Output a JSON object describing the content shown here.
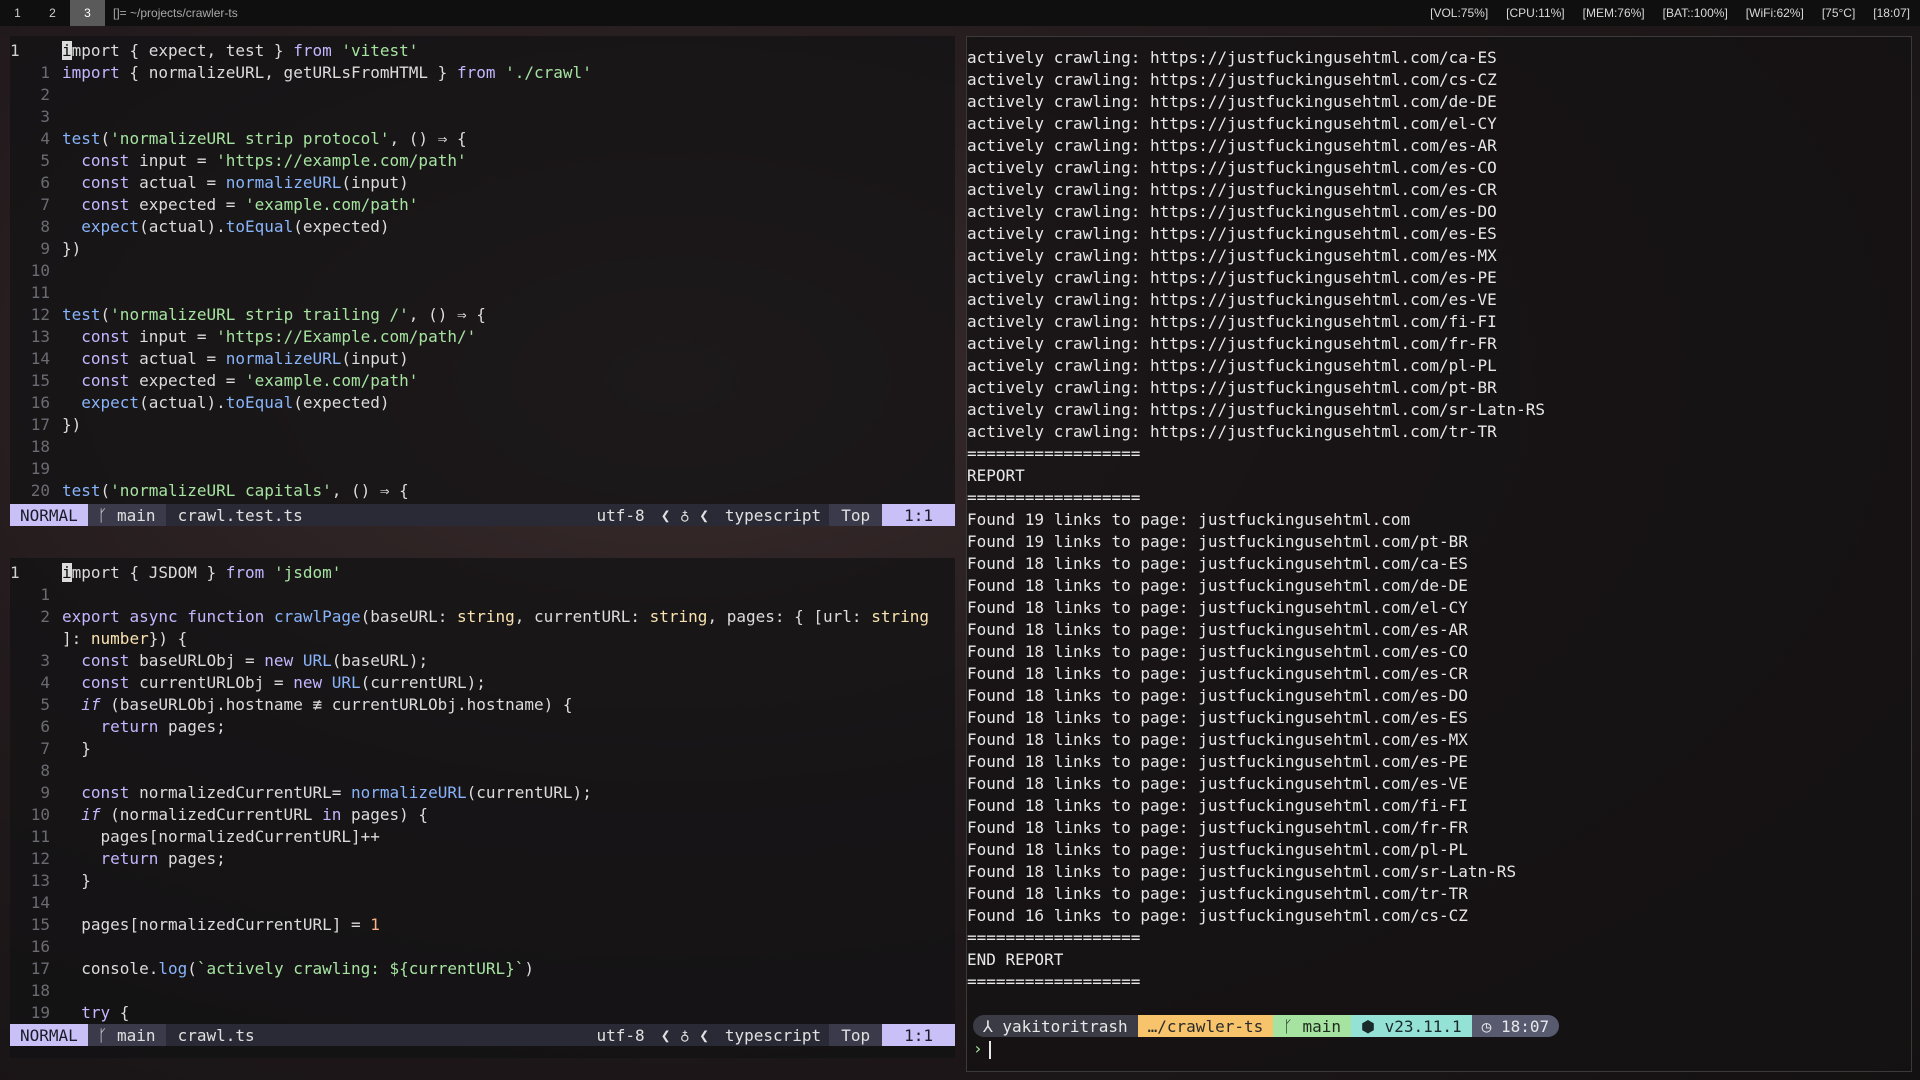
{
  "topbar": {
    "workspaces": [
      "1",
      "2",
      "3"
    ],
    "window_title": "[]= ~/projects/crawler-ts",
    "status": [
      "[VOL:75%]",
      "[CPU:11%]",
      "[MEM:76%]",
      "[BAT::100%]",
      "[WiFi:62%]",
      "[75°C]",
      "[18:07]"
    ]
  },
  "editor_top": {
    "statusline": {
      "mode": "NORMAL",
      "branch": "main",
      "file": "crawl.test.ts",
      "encoding": "utf-8",
      "filetype": "typescript",
      "scroll": "Top",
      "position": "1:1"
    },
    "lines": [
      {
        "n": "1",
        "t": "import { expect, test } from 'vitest'"
      },
      {
        "n": "1",
        "t": "import { normalizeURL, getURLsFromHTML } from './crawl'"
      },
      {
        "n": "2",
        "t": ""
      },
      {
        "n": "3",
        "t": ""
      },
      {
        "n": "4",
        "t": "test('normalizeURL strip protocol', () ⇒ {"
      },
      {
        "n": "5",
        "t": "  const input = 'https://example.com/path'"
      },
      {
        "n": "6",
        "t": "  const actual = normalizeURL(input)"
      },
      {
        "n": "7",
        "t": "  const expected = 'example.com/path'"
      },
      {
        "n": "8",
        "t": "  expect(actual).toEqual(expected)"
      },
      {
        "n": "9",
        "t": "})"
      },
      {
        "n": "10",
        "t": ""
      },
      {
        "n": "11",
        "t": ""
      },
      {
        "n": "12",
        "t": "test('normalizeURL strip trailing /', () ⇒ {"
      },
      {
        "n": "13",
        "t": "  const input = 'https://Example.com/path/'"
      },
      {
        "n": "14",
        "t": "  const actual = normalizeURL(input)"
      },
      {
        "n": "15",
        "t": "  const expected = 'example.com/path'"
      },
      {
        "n": "16",
        "t": "  expect(actual).toEqual(expected)"
      },
      {
        "n": "17",
        "t": "})"
      },
      {
        "n": "18",
        "t": ""
      },
      {
        "n": "19",
        "t": ""
      },
      {
        "n": "20",
        "t": "test('normalizeURL capitals', () ⇒ {"
      }
    ]
  },
  "editor_bottom": {
    "statusline": {
      "mode": "NORMAL",
      "branch": "main",
      "file": "crawl.ts",
      "encoding": "utf-8",
      "filetype": "typescript",
      "scroll": "Top",
      "position": "1:1"
    },
    "lines": [
      {
        "n": "1",
        "t": "import { JSDOM } from 'jsdom'"
      },
      {
        "n": "1",
        "t": ""
      },
      {
        "n": "2",
        "t": "export async function crawlPage(baseURL: string, currentURL: string, pages: { [url: string"
      },
      {
        "n": "",
        "t": "]: number}) {"
      },
      {
        "n": "3",
        "t": "  const baseURLObj = new URL(baseURL);"
      },
      {
        "n": "4",
        "t": "  const currentURLObj = new URL(currentURL);"
      },
      {
        "n": "5",
        "t": "  if (baseURLObj.hostname ≢ currentURLObj.hostname) {"
      },
      {
        "n": "6",
        "t": "    return pages;"
      },
      {
        "n": "7",
        "t": "  }"
      },
      {
        "n": "8",
        "t": ""
      },
      {
        "n": "9",
        "t": "  const normalizedCurrentURL= normalizeURL(currentURL);"
      },
      {
        "n": "10",
        "t": "  if (normalizedCurrentURL in pages) {"
      },
      {
        "n": "11",
        "t": "    pages[normalizedCurrentURL]++"
      },
      {
        "n": "12",
        "t": "    return pages;"
      },
      {
        "n": "13",
        "t": "  }"
      },
      {
        "n": "14",
        "t": ""
      },
      {
        "n": "15",
        "t": "  pages[normalizedCurrentURL] = 1"
      },
      {
        "n": "16",
        "t": ""
      },
      {
        "n": "17",
        "t": "  console.log(`actively crawling: ${currentURL}`)"
      },
      {
        "n": "18",
        "t": ""
      },
      {
        "n": "19",
        "t": "  try {"
      }
    ]
  },
  "terminal": {
    "lines": [
      "actively crawling: https://justfuckingusehtml.com/ca-ES",
      "actively crawling: https://justfuckingusehtml.com/cs-CZ",
      "actively crawling: https://justfuckingusehtml.com/de-DE",
      "actively crawling: https://justfuckingusehtml.com/el-CY",
      "actively crawling: https://justfuckingusehtml.com/es-AR",
      "actively crawling: https://justfuckingusehtml.com/es-CO",
      "actively crawling: https://justfuckingusehtml.com/es-CR",
      "actively crawling: https://justfuckingusehtml.com/es-DO",
      "actively crawling: https://justfuckingusehtml.com/es-ES",
      "actively crawling: https://justfuckingusehtml.com/es-MX",
      "actively crawling: https://justfuckingusehtml.com/es-PE",
      "actively crawling: https://justfuckingusehtml.com/es-VE",
      "actively crawling: https://justfuckingusehtml.com/fi-FI",
      "actively crawling: https://justfuckingusehtml.com/fr-FR",
      "actively crawling: https://justfuckingusehtml.com/pl-PL",
      "actively crawling: https://justfuckingusehtml.com/pt-BR",
      "actively crawling: https://justfuckingusehtml.com/sr-Latn-RS",
      "actively crawling: https://justfuckingusehtml.com/tr-TR",
      "==================",
      "REPORT",
      "==================",
      "Found 19 links to page: justfuckingusehtml.com",
      "Found 19 links to page: justfuckingusehtml.com/pt-BR",
      "Found 18 links to page: justfuckingusehtml.com/ca-ES",
      "Found 18 links to page: justfuckingusehtml.com/de-DE",
      "Found 18 links to page: justfuckingusehtml.com/el-CY",
      "Found 18 links to page: justfuckingusehtml.com/es-AR",
      "Found 18 links to page: justfuckingusehtml.com/es-CO",
      "Found 18 links to page: justfuckingusehtml.com/es-CR",
      "Found 18 links to page: justfuckingusehtml.com/es-DO",
      "Found 18 links to page: justfuckingusehtml.com/es-ES",
      "Found 18 links to page: justfuckingusehtml.com/es-MX",
      "Found 18 links to page: justfuckingusehtml.com/es-PE",
      "Found 18 links to page: justfuckingusehtml.com/es-VE",
      "Found 18 links to page: justfuckingusehtml.com/fi-FI",
      "Found 18 links to page: justfuckingusehtml.com/fr-FR",
      "Found 18 links to page: justfuckingusehtml.com/pl-PL",
      "Found 18 links to page: justfuckingusehtml.com/sr-Latn-RS",
      "Found 18 links to page: justfuckingusehtml.com/tr-TR",
      "Found 16 links to page: justfuckingusehtml.com/cs-CZ",
      "==================",
      "END REPORT",
      "=================="
    ],
    "prompt": {
      "user": "yakitoritrash",
      "dir": "…/crawler-ts",
      "git": "main",
      "node": "v23.11.1",
      "time": "18:07"
    },
    "cmd_symbol": "›"
  }
}
